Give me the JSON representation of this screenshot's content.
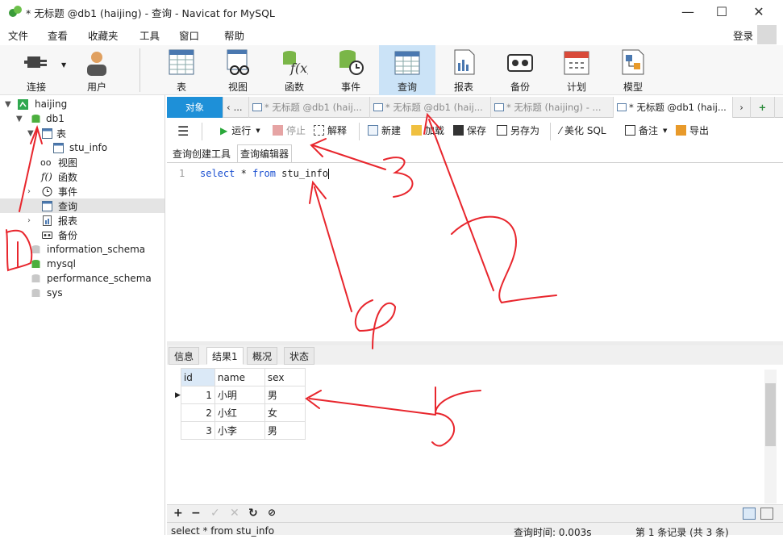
{
  "window": {
    "title": "* 无标题 @db1 (haijing) - 查询 - Navicat for MySQL"
  },
  "menu": [
    "文件",
    "查看",
    "收藏夹",
    "工具",
    "窗口",
    "帮助"
  ],
  "user": {
    "login": "登录"
  },
  "toolbar": [
    {
      "label": "连接",
      "icon": "plug-icon"
    },
    {
      "label": "用户",
      "icon": "user-icon"
    },
    {
      "label": "表",
      "icon": "table-icon"
    },
    {
      "label": "视图",
      "icon": "view-icon"
    },
    {
      "label": "函数",
      "icon": "function-icon"
    },
    {
      "label": "事件",
      "icon": "event-icon"
    },
    {
      "label": "查询",
      "icon": "query-icon"
    },
    {
      "label": "报表",
      "icon": "report-icon"
    },
    {
      "label": "备份",
      "icon": "backup-icon"
    },
    {
      "label": "计划",
      "icon": "schedule-icon"
    },
    {
      "label": "模型",
      "icon": "model-icon"
    }
  ],
  "tree": {
    "connection": "haijing",
    "database": "db1",
    "tables_node": "表",
    "table": "stu_info",
    "views": "视图",
    "functions": "函数",
    "events": "事件",
    "queries": "查询",
    "reports": "报表",
    "backups": "备份",
    "other_dbs": [
      "information_schema",
      "mysql",
      "performance_schema",
      "sys"
    ]
  },
  "tabs": {
    "objects": "对象",
    "more_left": "...",
    "items": [
      "* 无标题 @db1 (haij...",
      "* 无标题 @db1 (haij...",
      "* 无标题 (haijing) - ...",
      "* 无标题 @db1 (haij..."
    ]
  },
  "query_toolbar": {
    "run": "运行",
    "stop": "停止",
    "explain": "解释",
    "new": "新建",
    "load": "加载",
    "save": "保存",
    "save_as": "另存为",
    "beautify": "美化 SQL",
    "comment": "备注",
    "export": "导出"
  },
  "sub_tabs": {
    "builder": "查询创建工具",
    "editor": "查询编辑器"
  },
  "editor": {
    "line_number": "1",
    "kw1": "select",
    "star": " * ",
    "kw2": "from",
    "table": " stu_info"
  },
  "result_tabs": [
    "信息",
    "结果1",
    "概况",
    "状态"
  ],
  "result": {
    "columns": [
      "id",
      "name",
      "sex"
    ],
    "rows": [
      [
        "1",
        "小明",
        "男"
      ],
      [
        "2",
        "小红",
        "女"
      ],
      [
        "3",
        "小李",
        "男"
      ]
    ]
  },
  "status": {
    "sql": "select * from stu_info",
    "query_time": "查询时间: 0.003s",
    "records": "第 1 条记录 (共 3 条)"
  },
  "colors": {
    "accent": "#1e90d8",
    "annotation": "#e8262d",
    "selected_tab": "#cbe3f7"
  }
}
